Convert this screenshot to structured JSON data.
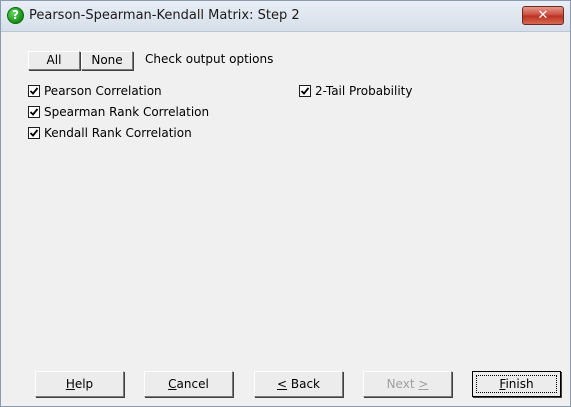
{
  "window": {
    "title": "Pearson-Spearman-Kendall Matrix: Step 2",
    "close_label": "✕"
  },
  "toolbar": {
    "all_label": "All",
    "none_label": "None",
    "hint": "Check output options"
  },
  "options_left": [
    {
      "label": "Pearson Correlation",
      "checked": true
    },
    {
      "label": "Spearman Rank Correlation",
      "checked": true
    },
    {
      "label": "Kendall Rank Correlation",
      "checked": true
    }
  ],
  "options_right": [
    {
      "label": "2-Tail Probability",
      "checked": true
    }
  ],
  "buttons": {
    "help": {
      "mnemonic": "H",
      "rest": "elp"
    },
    "cancel": {
      "mnemonic": "C",
      "rest": "ancel"
    },
    "back": {
      "mnemonic": "<",
      "rest": " Back"
    },
    "next": {
      "prefix": "Next ",
      "mnemonic": ">"
    },
    "finish": {
      "mnemonic": "F",
      "rest": "inish"
    }
  }
}
